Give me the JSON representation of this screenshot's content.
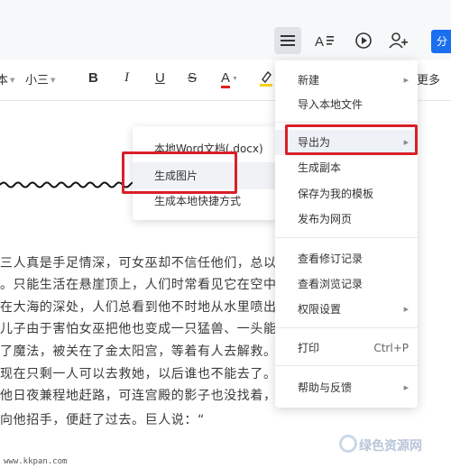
{
  "header": {
    "share_label": "分"
  },
  "icons": [
    "menu-icon",
    "text-style-icon",
    "play-icon",
    "add-user-icon"
  ],
  "toolbar": {
    "font_partial": "本",
    "font_size": "小三",
    "bold": "B",
    "italic": "I",
    "underline": "U",
    "strike": "S",
    "font_color": "A",
    "more_partial": "更多"
  },
  "document": {
    "lines": [
      "三人真是手足情深，可女巫却不信任他们，总以为",
      "。只能生活在悬崖顶上，人们时常看见它在空中不",
      "在大海的深处，人们总看到他不时地从水里喷出巨",
      "儿子由于害怕女巫把他也变成一只猛兽、一头能哎",
      "了魔法，被关在了金太阳宫，等着有人去解救。已",
      "现在只剩一人可以去救她，以后谁也不能去了。这",
      "他日夜兼程地赶路，可连宫殿的影子也没找着，最",
      "向他招手，便赶了过去。巨人说：“"
    ]
  },
  "submenu": {
    "items": [
      {
        "label": "本地Word文档(.docx)"
      },
      {
        "label": "生成图片"
      },
      {
        "label": "生成本地快捷方式"
      }
    ]
  },
  "menu": {
    "new": "新建",
    "import_local": "导入本地文件",
    "export_as": "导出为",
    "make_copy": "生成副本",
    "save_template": "保存为我的模板",
    "publish_web": "发布为网页",
    "revision_history": "查看修订记录",
    "view_history": "查看浏览记录",
    "permissions": "权限设置",
    "print": "打印",
    "print_shortcut": "Ctrl+P",
    "help": "帮助与反馈"
  },
  "colors": {
    "accent": "#1a6ff0",
    "highlight_box": "#d8202a",
    "font_color_underline": "#e0201e"
  },
  "watermark": {
    "url": "www.kkpan.com",
    "brand": "绿色资源网"
  }
}
